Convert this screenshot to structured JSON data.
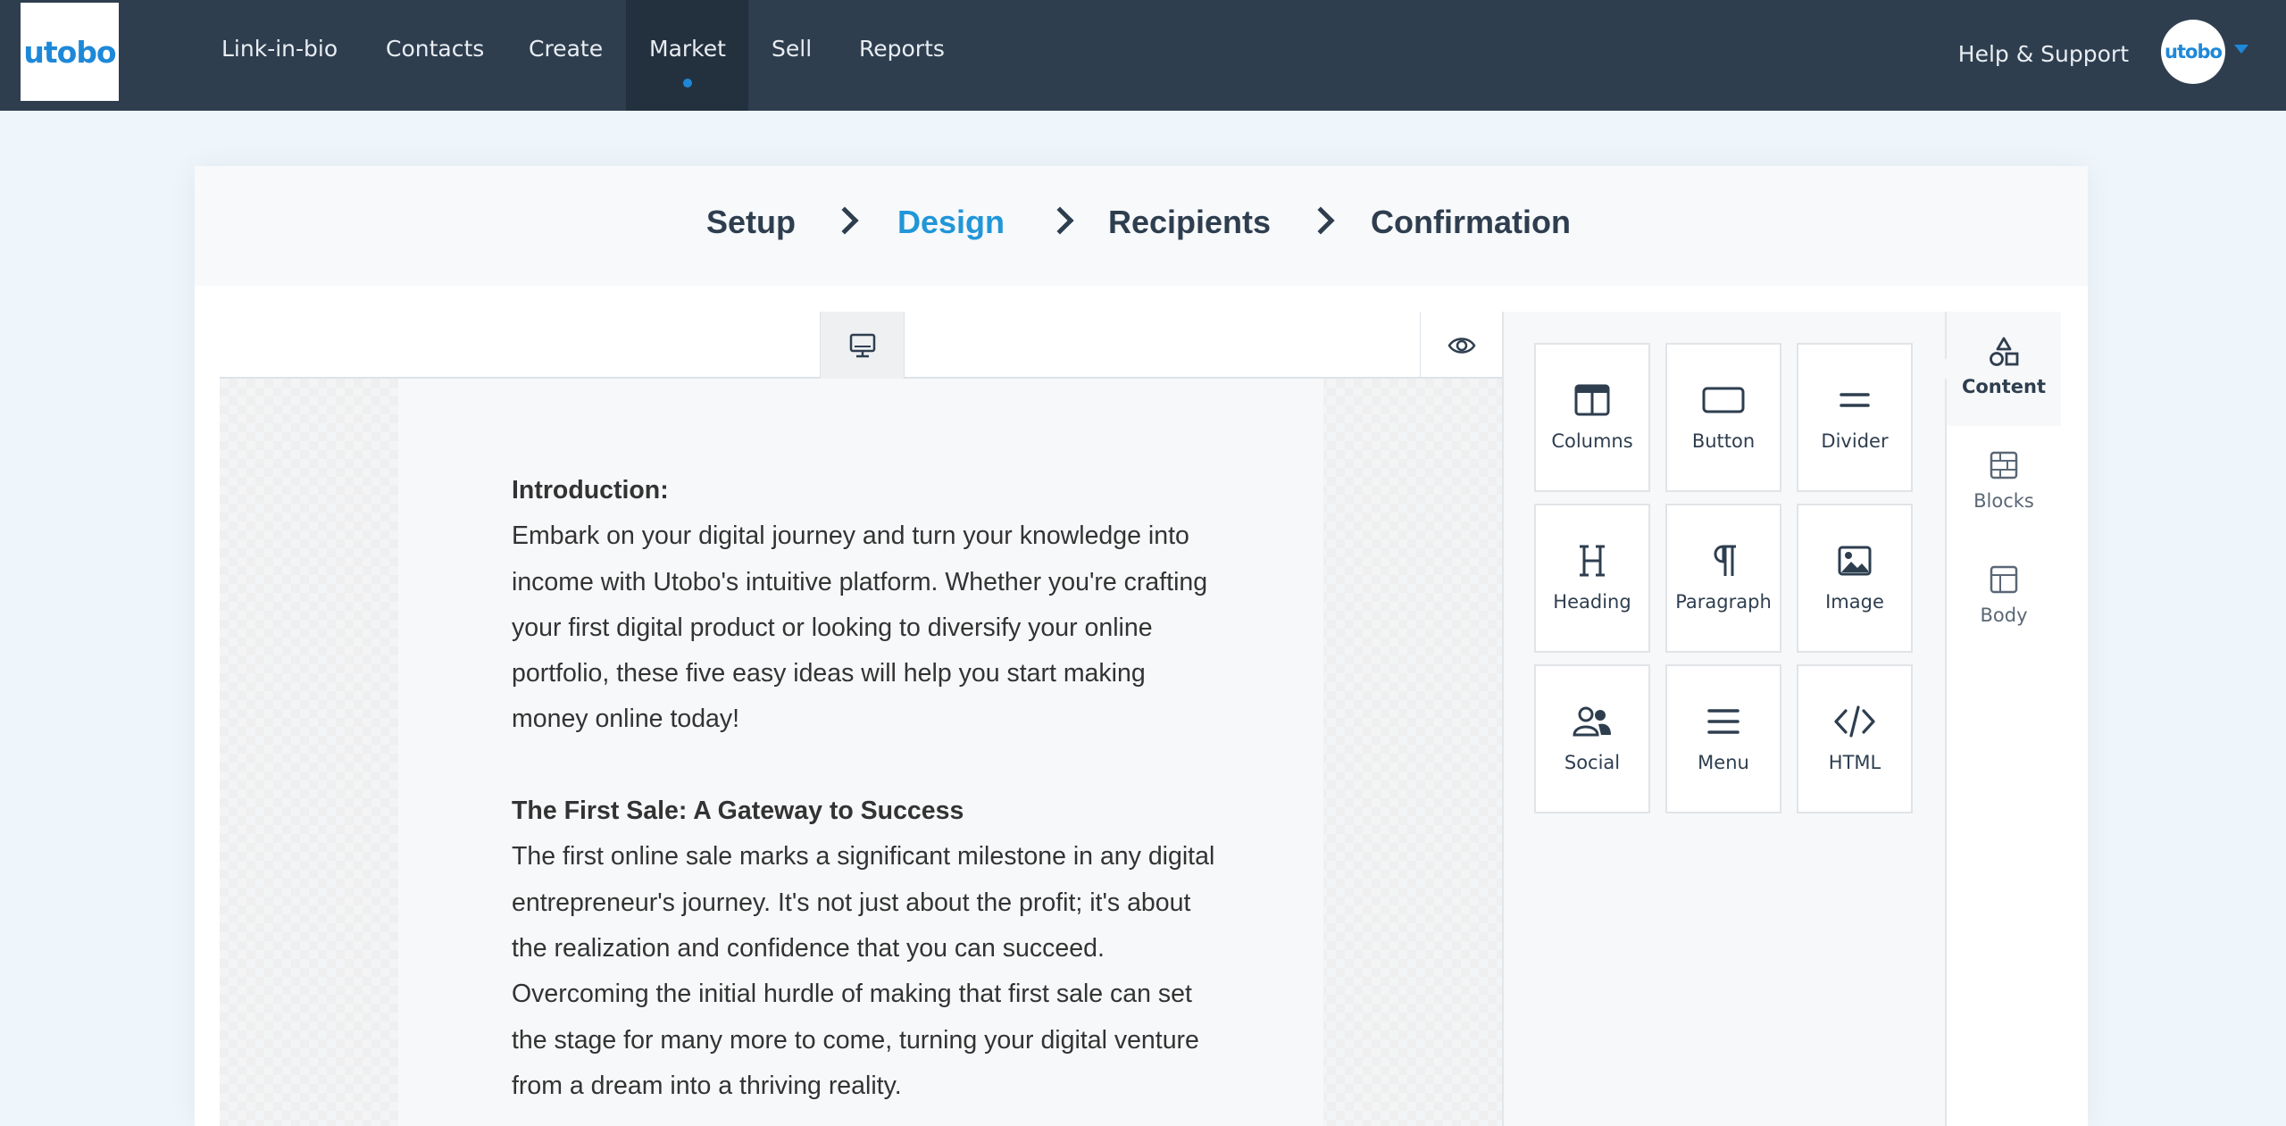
{
  "brand": {
    "logo_text": "utobo",
    "accent": "#1e88d8",
    "nav_bg": "#2e3e4f"
  },
  "nav": {
    "items": [
      {
        "label": "Link-in-bio"
      },
      {
        "label": "Contacts"
      },
      {
        "label": "Create"
      },
      {
        "label": "Market",
        "active": true
      },
      {
        "label": "Sell"
      },
      {
        "label": "Reports"
      }
    ],
    "help_label": "Help & Support",
    "avatar_text": "utobo"
  },
  "steps": [
    {
      "label": "Setup"
    },
    {
      "label": "Design",
      "active": true
    },
    {
      "label": "Recipients"
    },
    {
      "label": "Confirmation"
    }
  ],
  "toolbar": {
    "device_icon": "desktop-icon",
    "preview_icon": "eye-icon"
  },
  "email": {
    "intro_heading": "Introduction:",
    "intro_body": "Embark on your digital journey and turn your knowledge into income with Utobo's intuitive platform. Whether you're crafting your first digital product or looking to diversify your online portfolio, these five easy ideas will help you start making money online today!",
    "section_heading": "The First Sale: A Gateway to Success",
    "section_body": "The first online sale marks a significant milestone in any digital entrepreneur's journey. It's not just about the profit; it's about the realization and confidence that you can succeed. Overcoming the initial hurdle of making that first sale can set the stage for many more to come, turning your digital venture from a dream into a thriving reality."
  },
  "tools": [
    {
      "label": "Columns",
      "icon": "columns-icon"
    },
    {
      "label": "Button",
      "icon": "button-icon"
    },
    {
      "label": "Divider",
      "icon": "divider-icon"
    },
    {
      "label": "Heading",
      "icon": "heading-icon"
    },
    {
      "label": "Paragraph",
      "icon": "paragraph-icon"
    },
    {
      "label": "Image",
      "icon": "image-icon"
    },
    {
      "label": "Social",
      "icon": "social-icon"
    },
    {
      "label": "Menu",
      "icon": "menu-icon"
    },
    {
      "label": "HTML",
      "icon": "code-icon"
    }
  ],
  "side_tabs": [
    {
      "label": "Content",
      "icon": "shapes-icon",
      "active": true
    },
    {
      "label": "Blocks",
      "icon": "blocks-icon"
    },
    {
      "label": "Body",
      "icon": "layout-icon"
    }
  ]
}
